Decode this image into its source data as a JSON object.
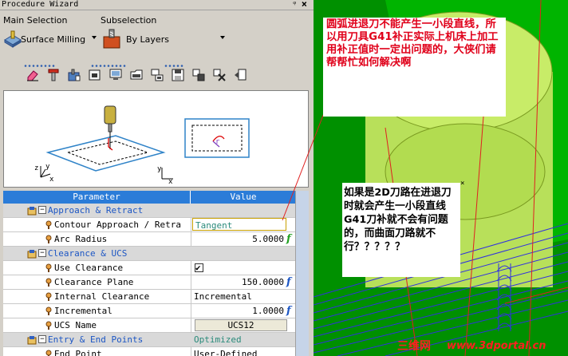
{
  "window": {
    "title": "Procedure Wizard",
    "pin": "ᵠ",
    "close": "×"
  },
  "selection": {
    "main_label": "Main Selection",
    "main_value": "Surface Milling",
    "sub_label": "Subselection",
    "sub_value": "By Layers"
  },
  "toolbar": {
    "icons": [
      "eraser-icon",
      "tool-icon",
      "stock-icon",
      "machine-icon",
      "monitor-icon",
      "folder-icon",
      "network-icon",
      "save-icon",
      "settings-icon",
      "tools-icon",
      "export-icon"
    ]
  },
  "preview": {
    "axis_z": "z",
    "axis_y": "y",
    "axis_x": "x",
    "axis2_y": "y",
    "axis2_x": "x",
    "radius_label": "r"
  },
  "grid": {
    "col_param": "Parameter",
    "col_value": "Value",
    "rows": [
      {
        "kind": "group",
        "name": "Approach & Retract",
        "value": ""
      },
      {
        "kind": "item",
        "name": "Contour Approach / Retra",
        "value": "Tangent"
      },
      {
        "kind": "item",
        "name": "Arc Radius",
        "value": "5.0000",
        "formula": "f"
      },
      {
        "kind": "group",
        "name": "Clearance & UCS",
        "value": ""
      },
      {
        "kind": "item",
        "name": "Use Clearance",
        "value": "✔"
      },
      {
        "kind": "item",
        "name": "Clearance Plane",
        "value": "150.0000",
        "formula": "f"
      },
      {
        "kind": "item",
        "name": "Internal Clearance",
        "value": "Incremental"
      },
      {
        "kind": "item",
        "name": "Incremental",
        "value": "1.0000",
        "formula": "f"
      },
      {
        "kind": "item",
        "name": "UCS Name",
        "value": "UCS12"
      },
      {
        "kind": "group",
        "name": "Entry & End Points",
        "value": "Optimized"
      },
      {
        "kind": "item",
        "name": "End Point",
        "value": "User-Defined"
      }
    ]
  },
  "notes": {
    "note1": "圆弧进退刀不能产生一小段直线，所以用刀具G41补正实际上机床上加工用补正值时一定出问题的，大侠们请帮帮忙如何解决啊",
    "note2": "如果是2D刀路在进退刀时就会产生一小段直线G41刀补就不会有问题的，而曲面刀路就不行？？？？？"
  },
  "watermark": {
    "cn": "三维网",
    "url": "www.3dportal.cn"
  },
  "colors": {
    "header_blue": "#2b7cd8",
    "group_text": "#1c56c4",
    "viewport_green": "#00b400",
    "note_red": "#e0001a"
  }
}
